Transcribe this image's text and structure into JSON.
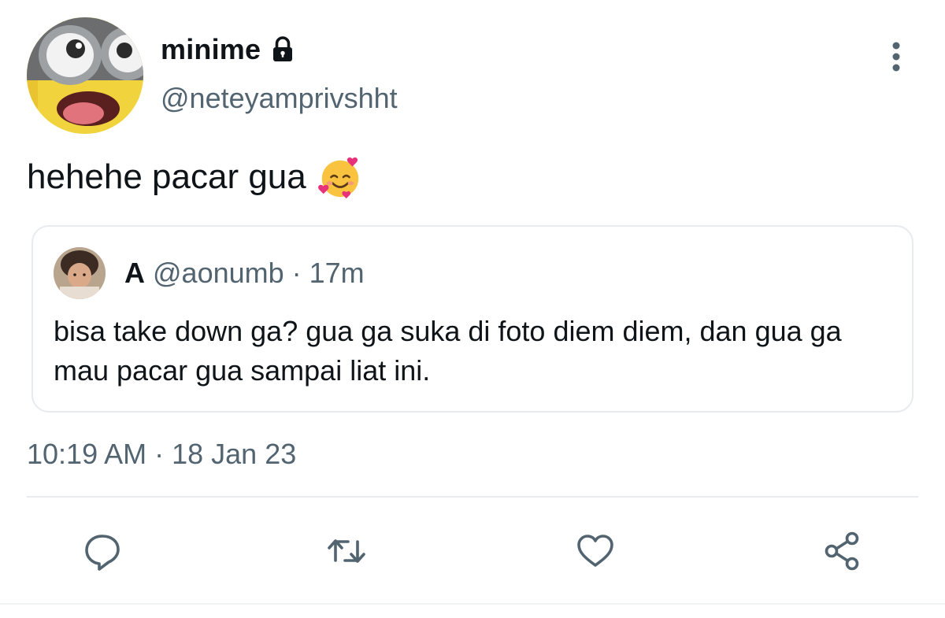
{
  "tweet": {
    "author": {
      "display_name": "minime",
      "handle": "@neteyamprivshht",
      "protected": true
    },
    "text": "hehehe pacar gua",
    "emoji": "smiling-face-with-hearts",
    "timestamp": {
      "time": "10:19 AM",
      "separator": "·",
      "date": "18 Jan 23"
    }
  },
  "quote": {
    "display_name": "A",
    "handle": "@aonumb",
    "separator": "·",
    "relative_time": "17m",
    "text": "bisa take down ga? gua ga suka di foto diem diem, dan gua ga mau pacar gua sampai liat ini."
  },
  "actions": {
    "icons": [
      "reply-icon",
      "retweet-icon",
      "like-icon",
      "share-icon"
    ]
  },
  "colors": {
    "text_primary": "#0f1419",
    "text_secondary": "#536471",
    "border": "#e7ebee",
    "icon": "#536471"
  }
}
